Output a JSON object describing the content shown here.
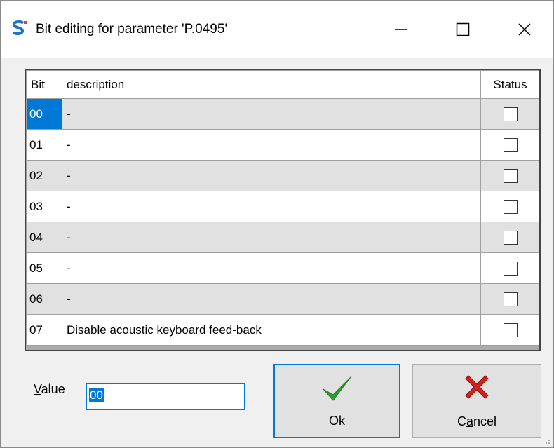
{
  "window": {
    "title": "Bit editing for parameter 'P.0495'"
  },
  "titlebar_buttons": {
    "minimize": "—",
    "maximize": "☐",
    "close": "✕"
  },
  "grid": {
    "headers": {
      "bit": "Bit",
      "description": "description",
      "status": "Status"
    },
    "rows": [
      {
        "bit": "00",
        "description": "-",
        "checked": false
      },
      {
        "bit": "01",
        "description": "-",
        "checked": false
      },
      {
        "bit": "02",
        "description": "-",
        "checked": false
      },
      {
        "bit": "03",
        "description": "-",
        "checked": false
      },
      {
        "bit": "04",
        "description": "-",
        "checked": false
      },
      {
        "bit": "05",
        "description": "-",
        "checked": false
      },
      {
        "bit": "06",
        "description": "-",
        "checked": false
      },
      {
        "bit": "07",
        "description": "Disable acoustic keyboard feed-back",
        "checked": false
      }
    ],
    "selected_row": "00"
  },
  "value": {
    "label": "Value",
    "input": "00"
  },
  "buttons": {
    "ok": "Ok",
    "cancel": "Cancel"
  },
  "colors": {
    "accent": "#0078d7",
    "ok_green": "#2e9e2e",
    "cancel_red": "#d32020"
  }
}
